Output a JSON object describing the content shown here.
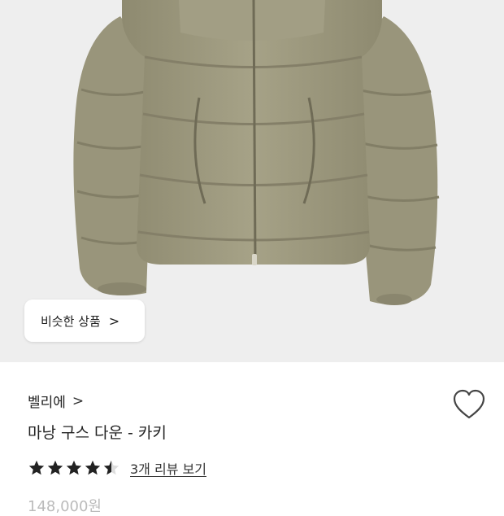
{
  "similar_button": {
    "label": "비슷한 상품",
    "chevron": ">"
  },
  "brand": {
    "name": "벨리에",
    "chevron": ">"
  },
  "product": {
    "title": "마낭 구스 다운 - 카키",
    "price": "148,000원"
  },
  "rating": {
    "value": 4.5,
    "max": 5,
    "review_link": "3개 리뷰 보기"
  },
  "icons": {
    "heart": "heart-outline-icon",
    "star": "star-icon",
    "chevron": "chevron-right-icon"
  },
  "colors": {
    "jacket": "#9e9a80",
    "hero_background": "#eeeeee",
    "star": "#222222"
  }
}
